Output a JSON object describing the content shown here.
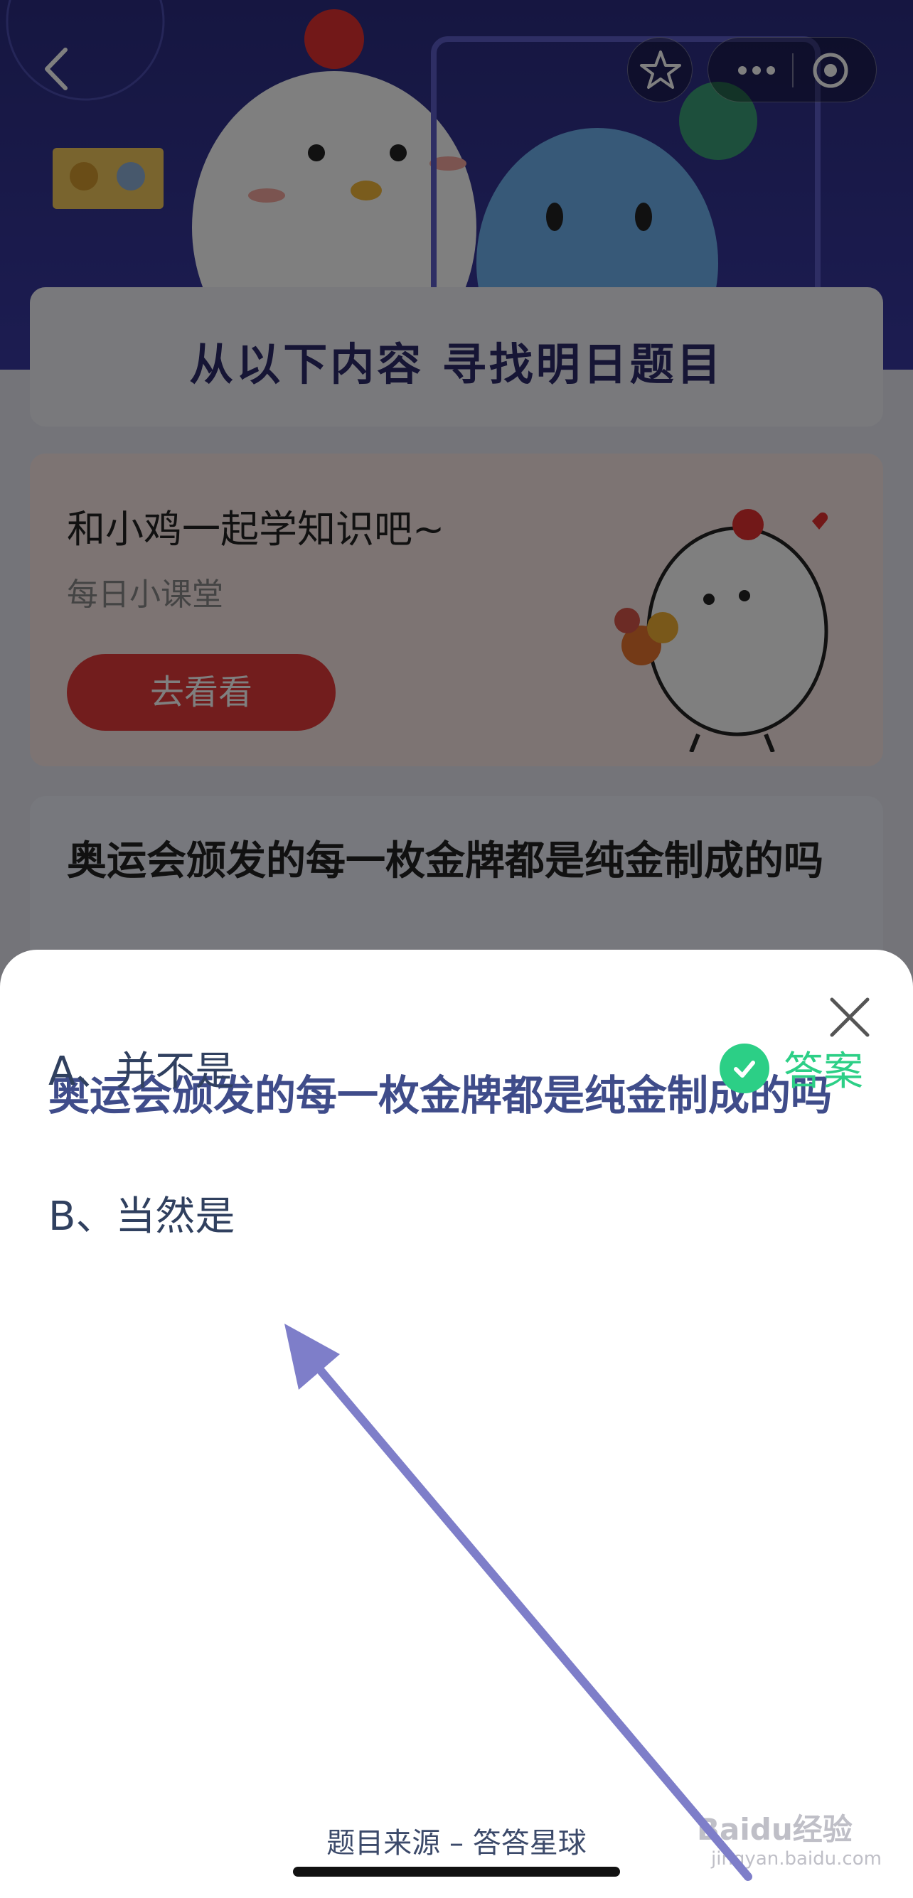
{
  "background": {
    "banner_title": "从以下内容 寻找明日题目",
    "course_card": {
      "title": "和小鸡一起学知识吧~",
      "subtitle": "每日小课堂",
      "button_label": "去看看"
    },
    "question_card": {
      "question": "奥运会颁发的每一枚金牌都是纯金制成的吗"
    }
  },
  "answer_sheet": {
    "question": "奥运会颁发的每一枚金牌都是纯金制成的吗",
    "options": [
      {
        "label": "A、并不是",
        "is_answer": true
      },
      {
        "label": "B、当然是",
        "is_answer": false
      }
    ],
    "answer_badge": "答案",
    "source": "题目来源 – 答答星球"
  },
  "watermark": {
    "brand": "Baidu经验",
    "url": "jingyan.baidu.com"
  },
  "colors": {
    "accent_green": "#2ccf86",
    "question_blue": "#3f4c8a",
    "arrow_purple": "#7e7ec9"
  }
}
